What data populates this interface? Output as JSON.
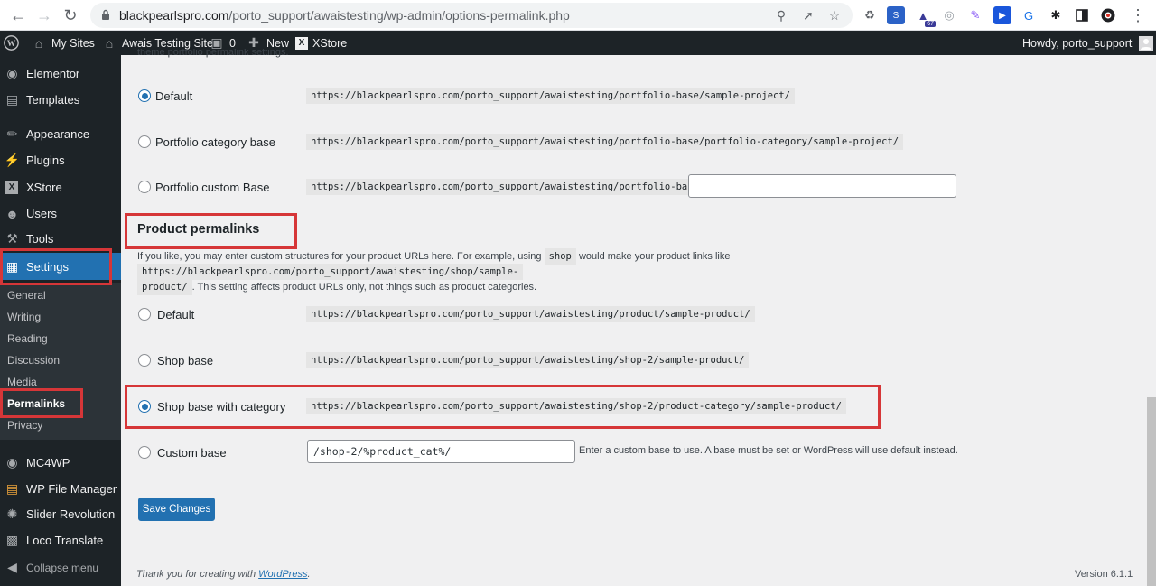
{
  "browser": {
    "url_host": "blackpearlspro.com",
    "url_path": "/porto_support/awaistesting/wp-admin/options-permalink.php",
    "badge_count": "67"
  },
  "admin_bar": {
    "my_sites": "My Sites",
    "site_name": "Awais Testing Site",
    "comments_count": "0",
    "new_label": "New",
    "xstore": "XStore",
    "howdy": "Howdy, porto_support"
  },
  "sidebar": {
    "items": [
      {
        "label": "Elementor",
        "icon": "elementor-icon"
      },
      {
        "label": "Templates",
        "icon": "folder-icon"
      },
      {
        "label": "Appearance",
        "icon": "brush-icon"
      },
      {
        "label": "Plugins",
        "icon": "plugin-icon"
      },
      {
        "label": "XStore",
        "icon": "xstore-icon"
      },
      {
        "label": "Users",
        "icon": "users-icon"
      },
      {
        "label": "Tools",
        "icon": "wrench-icon"
      },
      {
        "label": "Settings",
        "icon": "settings-icon"
      }
    ],
    "submenu": [
      "General",
      "Writing",
      "Reading",
      "Discussion",
      "Media",
      "Permalinks",
      "Privacy"
    ],
    "items2": [
      {
        "label": "MC4WP",
        "icon": "mc4wp-icon"
      },
      {
        "label": "WP File Manager",
        "icon": "file-manager-icon"
      },
      {
        "label": "Slider Revolution",
        "icon": "slider-icon"
      },
      {
        "label": "Loco Translate",
        "icon": "translate-icon"
      },
      {
        "label": "Collapse menu",
        "icon": "collapse-icon"
      }
    ]
  },
  "top_cut_text": "theme portfolio permalink settings.",
  "portfolio": {
    "options": [
      {
        "label": "Default",
        "code": "https://blackpearlspro.com/porto_support/awaistesting/portfolio-base/sample-project/",
        "checked": true
      },
      {
        "label": "Portfolio category base",
        "code": "https://blackpearlspro.com/porto_support/awaistesting/portfolio-base/portfolio-category/sample-project/",
        "checked": false
      },
      {
        "label": "Portfolio custom Base",
        "code": "https://blackpearlspro.com/porto_support/awaistesting/portfolio-base",
        "checked": false
      }
    ],
    "custom_value": ""
  },
  "product": {
    "title": "Product permalinks",
    "desc_1": "If you like, you may enter custom structures for your product URLs here. For example, using",
    "desc_code1": "shop",
    "desc_2": "would make your product links like",
    "desc_code2a": "https://blackpearlspro.com/porto_support/awaistesting/shop/sample-",
    "desc_code2b": "product/",
    "desc_3": ". This setting affects product URLs only, not things such as product categories.",
    "options": [
      {
        "label": "Default",
        "code": "https://blackpearlspro.com/porto_support/awaistesting/product/sample-product/",
        "checked": false
      },
      {
        "label": "Shop base",
        "code": "https://blackpearlspro.com/porto_support/awaistesting/shop-2/sample-product/",
        "checked": false
      },
      {
        "label": "Shop base with category",
        "code": "https://blackpearlspro.com/porto_support/awaistesting/shop-2/product-category/sample-product/",
        "checked": true
      },
      {
        "label": "Custom base",
        "checked": false
      }
    ],
    "custom_base_value": "/shop-2/%product_cat%/",
    "custom_base_hint": "Enter a custom base to use. A base must be set or WordPress will use default instead."
  },
  "save_button": "Save Changes",
  "footer": {
    "thanks": "Thank you for creating with",
    "wp_link": "WordPress",
    "period": ".",
    "version": "Version 6.1.1"
  }
}
